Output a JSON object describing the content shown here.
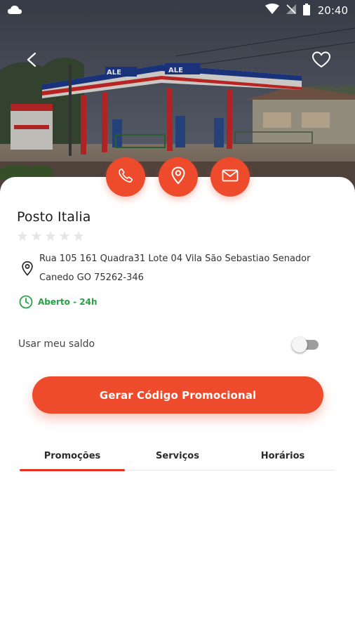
{
  "status_bar": {
    "time": "20:40",
    "icons": [
      "cloud-icon",
      "wifi-icon",
      "signal-icon",
      "battery-icon"
    ]
  },
  "header": {
    "back_icon": "chevron-left-icon",
    "favorite_icon": "heart-icon",
    "photo": "gas-station-photo"
  },
  "actions": [
    {
      "name": "call-button",
      "icon": "phone-icon"
    },
    {
      "name": "map-button",
      "icon": "location-pin-icon"
    },
    {
      "name": "email-button",
      "icon": "mail-icon"
    }
  ],
  "station": {
    "name": "Posto Italia",
    "rating": 0,
    "rating_max": 5,
    "address": "Rua 105 161 Quadra31 Lote 04 Vila São Sebastiao Senador Canedo GO 75262-346",
    "hours": "Aberto - 24h"
  },
  "balance": {
    "label": "Usar meu saldo",
    "enabled": false
  },
  "cta": {
    "label": "Gerar Código Promocional"
  },
  "tabs": [
    {
      "label": "Promoções",
      "active": true
    },
    {
      "label": "Serviços",
      "active": false
    },
    {
      "label": "Horários",
      "active": false
    }
  ],
  "colors": {
    "accent": "#ee4a2c",
    "tab_indicator": "#e8321f",
    "open_green": "#27a244",
    "text_dark": "#1c1c1c",
    "star_empty": "#e6e6e6"
  }
}
